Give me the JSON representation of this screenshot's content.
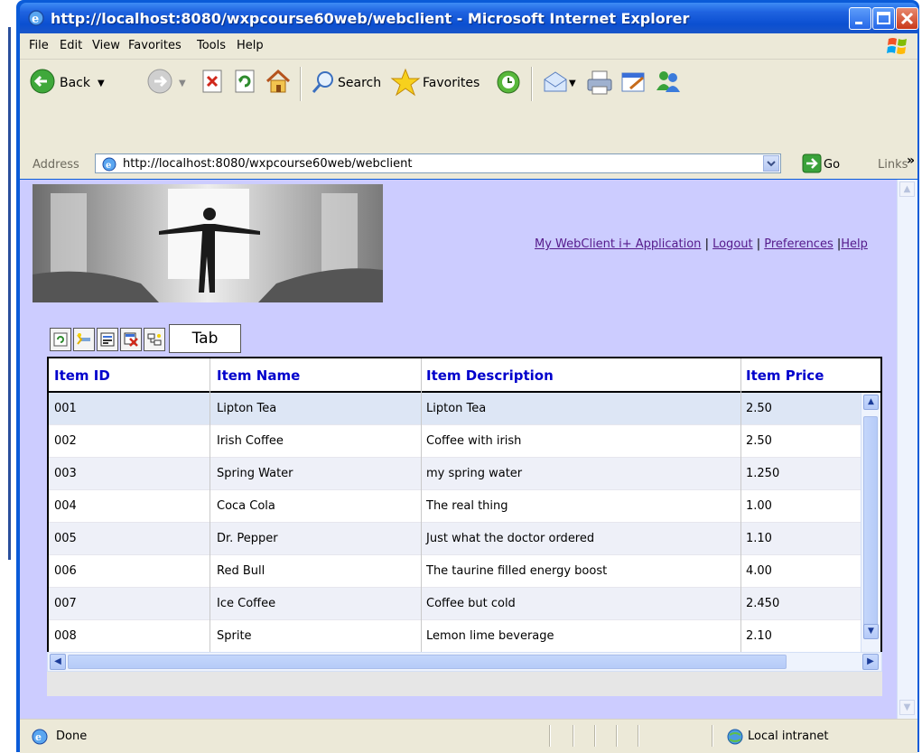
{
  "window": {
    "title": "http://localhost:8080/wxpcourse60web/webclient - Microsoft Internet Explorer"
  },
  "menu": [
    "File",
    "Edit",
    "View",
    "Favorites",
    "Tools",
    "Help"
  ],
  "toolbar": {
    "back_label": "Back",
    "search_label": "Search",
    "favorites_label": "Favorites"
  },
  "address": {
    "label": "Address",
    "url": "http://localhost:8080/wxpcourse60web/webclient",
    "go_label": "Go",
    "links_label": "Links",
    "chevron": "»"
  },
  "page": {
    "links": {
      "app": "My WebClient i+ Application",
      "sep1": " | ",
      "logout": "Logout",
      "sep2": " | ",
      "preferences": "Preferences",
      "sep3": " |",
      "help": "Help"
    },
    "tab_label": "Tab",
    "grid": {
      "columns": [
        "Item ID",
        "Item Name",
        "Item Description",
        "Item Price"
      ],
      "rows": [
        [
          "001",
          "Lipton Tea",
          "Lipton Tea",
          "2.50"
        ],
        [
          "002",
          "Irish Coffee",
          "Coffee with irish",
          "2.50"
        ],
        [
          "003",
          "Spring Water",
          "my spring water",
          "1.250"
        ],
        [
          "004",
          "Coca Cola",
          "The real thing",
          "1.00"
        ],
        [
          "005",
          "Dr. Pepper",
          "Just what the doctor ordered",
          "1.10"
        ],
        [
          "006",
          "Red Bull",
          "The taurine filled energy boost",
          "4.00"
        ],
        [
          "007",
          "Ice Coffee",
          "Coffee but cold",
          "2.450"
        ],
        [
          "008",
          "Sprite",
          "Lemon lime beverage",
          "2.10"
        ]
      ]
    }
  },
  "status": {
    "text": "Done",
    "zone": "Local intranet"
  },
  "colors": {
    "content_bg": "#ccccff",
    "selected_row": "#dde6f5",
    "alt_row": "#eef0f8",
    "header_text": "#0000cc",
    "title_bar": "#0b4fd1"
  }
}
